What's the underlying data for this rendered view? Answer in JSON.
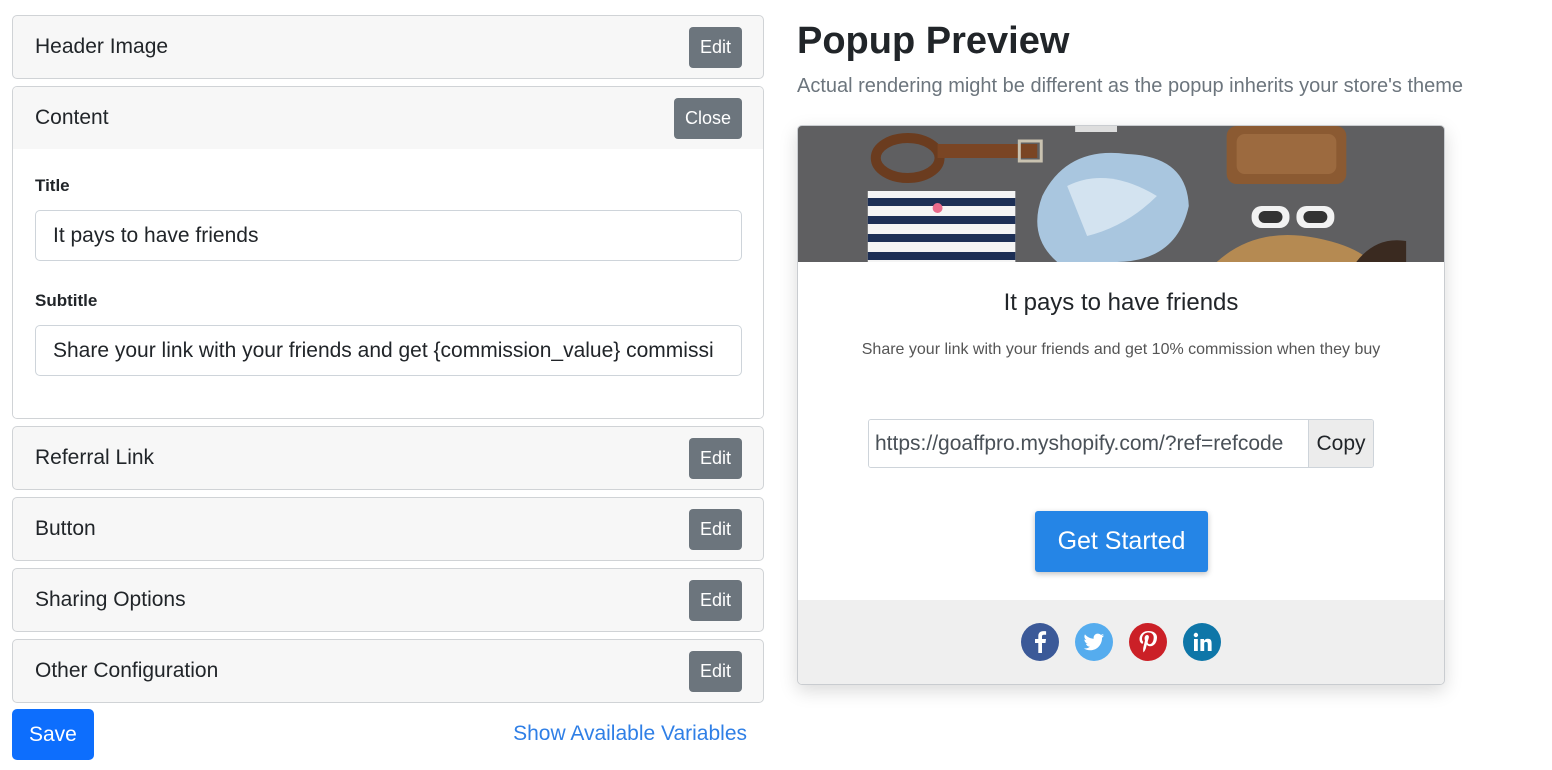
{
  "sections": {
    "header_image": {
      "title": "Header Image",
      "button": "Edit"
    },
    "content": {
      "title": "Content",
      "button": "Close",
      "title_label": "Title",
      "title_value": "It pays to have friends",
      "subtitle_label": "Subtitle",
      "subtitle_value": "Share your link with your friends and get {commission_value} commissi"
    },
    "referral_link": {
      "title": "Referral Link",
      "button": "Edit"
    },
    "button": {
      "title": "Button",
      "button": "Edit"
    },
    "sharing_options": {
      "title": "Sharing Options",
      "button": "Edit"
    },
    "other_configuration": {
      "title": "Other Configuration",
      "button": "Edit"
    }
  },
  "actions": {
    "save": "Save",
    "show_variables": "Show Available Variables"
  },
  "preview": {
    "heading": "Popup Preview",
    "note": "Actual rendering might be different as the popup inherits your store's theme",
    "popup_title": "It pays to have friends",
    "popup_subtitle": "Share your link with your friends and get 10% commission when they buy",
    "referral_url": "https://goaffpro.myshopify.com/?ref=refcode",
    "copy_label": "Copy",
    "cta_label": "Get Started",
    "share_icons": [
      "facebook-icon",
      "twitter-icon",
      "pinterest-icon",
      "linkedin-icon"
    ]
  },
  "colors": {
    "primary": "#0d6efd",
    "cta": "#2585e6",
    "secondary": "#6c757d",
    "link": "#2f7fe6"
  }
}
